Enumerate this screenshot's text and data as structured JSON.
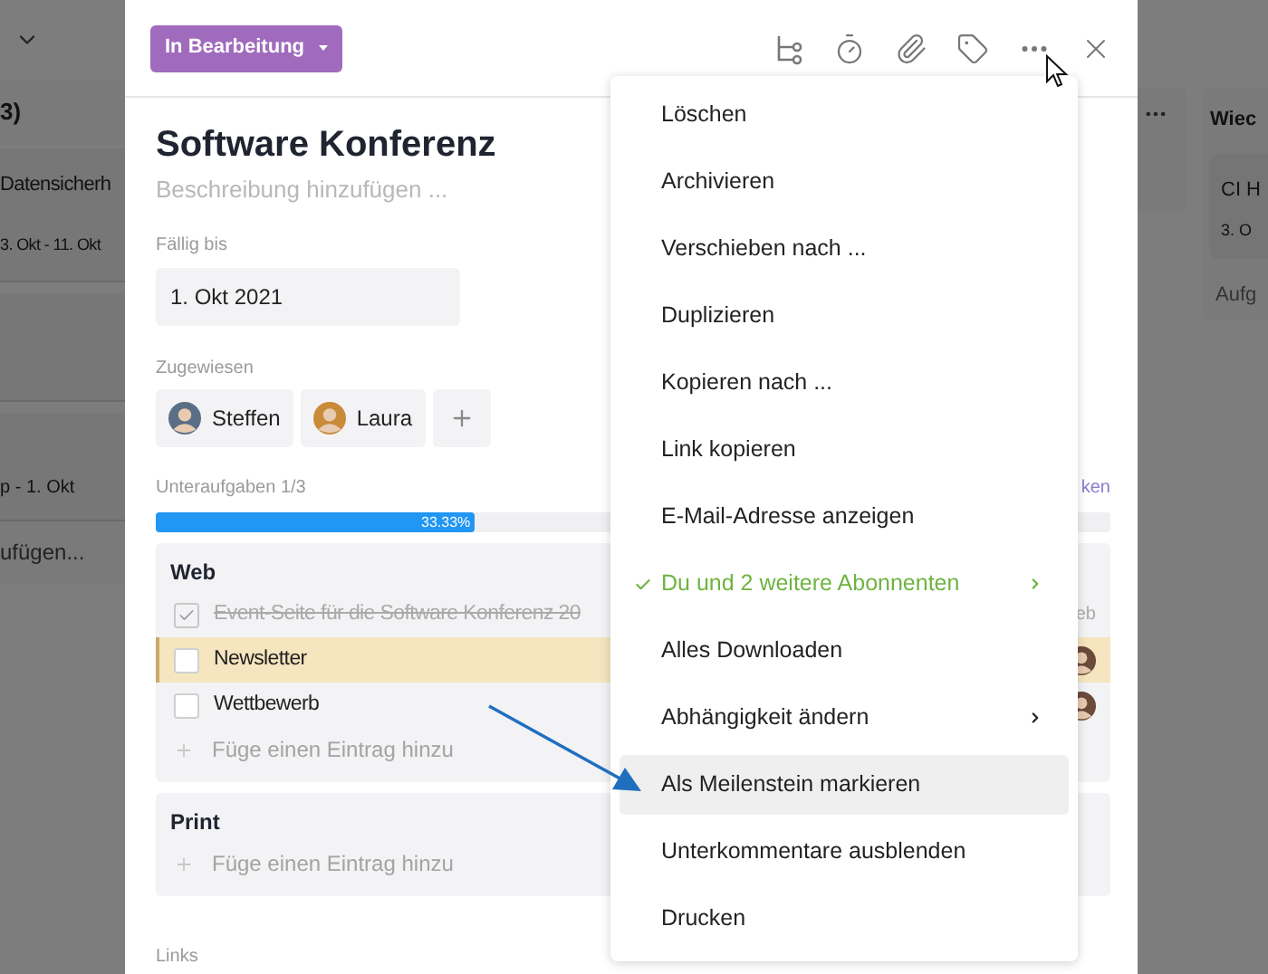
{
  "board_left": {
    "header": "3)",
    "card_title": "Datensicherh",
    "card_date": "3. Okt - 11. Okt",
    "second_card_date": "p - 1. Okt",
    "add_task": "ufügen..."
  },
  "board_right": {
    "column_title": "Wiec",
    "card_title": "CI H",
    "card_date": "3. O",
    "add_task": "Aufg"
  },
  "status_button": {
    "label": "In Bearbeitung"
  },
  "task": {
    "title": "Software Konferenz",
    "description": {
      "placeholder": "Beschreibung hinzufügen ..."
    },
    "due": {
      "label": "Fällig bis",
      "value": "1. Okt 2021"
    },
    "assignees": {
      "label": "Zugewiesen",
      "people": [
        {
          "name": "Steffen",
          "color": "#5a6f86"
        },
        {
          "name": "Laura",
          "color": "#c98a3a"
        }
      ]
    },
    "subtasks": {
      "label": "Unteraufgaben 1/3",
      "link": "ken",
      "level": 0.3333,
      "percent": "33.33%"
    },
    "checklists": [
      {
        "title": "Web",
        "add_placeholder": "Füge einen Eintrag hinzu",
        "items": [
          {
            "label": "Event-Seite für die Software Konferenz 20",
            "checked": true,
            "selected": false,
            "side_text": "eb",
            "avatar": false
          },
          {
            "label": "Newsletter",
            "checked": false,
            "selected": true,
            "avatar": true
          },
          {
            "label": "Wettbewerb",
            "checked": false,
            "selected": false,
            "avatar": true
          }
        ]
      },
      {
        "title": "Print",
        "add_placeholder": "Füge einen Eintrag hinzu"
      }
    ],
    "links_label": "Links"
  },
  "menu": {
    "items": [
      {
        "label": "Löschen",
        "checked": false,
        "submenu": false,
        "selected": false
      },
      {
        "label": "Archivieren",
        "checked": false,
        "submenu": false,
        "selected": false
      },
      {
        "label": "Verschieben nach ...",
        "checked": false,
        "submenu": false,
        "selected": false
      },
      {
        "label": "Duplizieren",
        "checked": false,
        "submenu": false,
        "selected": false
      },
      {
        "label": "Kopieren nach ...",
        "checked": false,
        "submenu": false,
        "selected": false
      },
      {
        "label": "Link kopieren",
        "checked": false,
        "submenu": false,
        "selected": false
      },
      {
        "label": "E-Mail-Adresse anzeigen",
        "checked": false,
        "submenu": false,
        "selected": false
      },
      {
        "label": "Du und 2 weitere Abonnenten",
        "checked": true,
        "submenu": true,
        "selected": false
      },
      {
        "label": "Alles Downloaden",
        "checked": false,
        "submenu": false,
        "selected": false
      },
      {
        "label": "Abhängigkeit ändern",
        "checked": false,
        "submenu": true,
        "selected": false
      },
      {
        "label": "Als Meilenstein markieren",
        "checked": false,
        "submenu": false,
        "selected": true
      },
      {
        "label": "Unterkommentare ausblenden",
        "checked": false,
        "submenu": false,
        "selected": false
      },
      {
        "label": "Drucken",
        "checked": false,
        "submenu": false,
        "selected": false
      }
    ]
  }
}
